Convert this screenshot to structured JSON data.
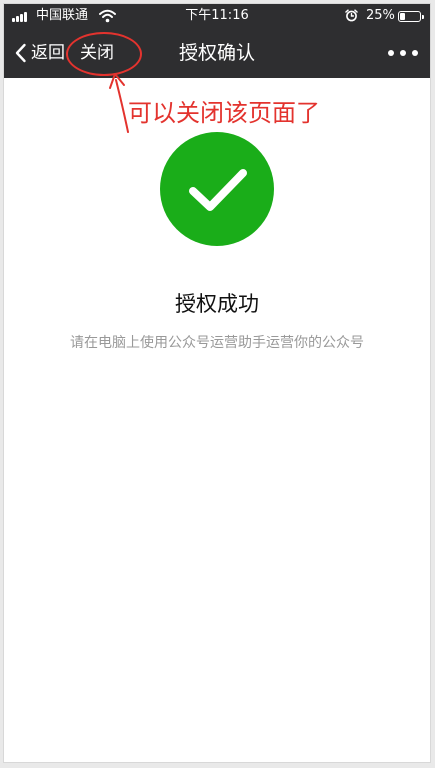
{
  "status_bar": {
    "carrier": "中国联通",
    "time": "下午11:16",
    "battery_text": "25%",
    "battery_level": 0.25
  },
  "nav_bar": {
    "back_label": "返回",
    "close_label": "关闭",
    "title": "授权确认"
  },
  "annotation": {
    "text": "可以关闭该页面了",
    "color": "#e3332e"
  },
  "content": {
    "title": "授权成功",
    "description": "请在电脑上使用公众号运营助手运营你的公众号"
  },
  "colors": {
    "nav_background": "#2e2e30",
    "success_green": "#1aad19",
    "description_gray": "#999999"
  },
  "icons": {
    "back": "chevron-left-icon",
    "more": "more-dots-icon",
    "success": "check-circle-icon",
    "wifi": "wifi-icon",
    "alarm": "alarm-clock-icon",
    "signal": "signal-bars-icon",
    "battery": "battery-icon"
  }
}
